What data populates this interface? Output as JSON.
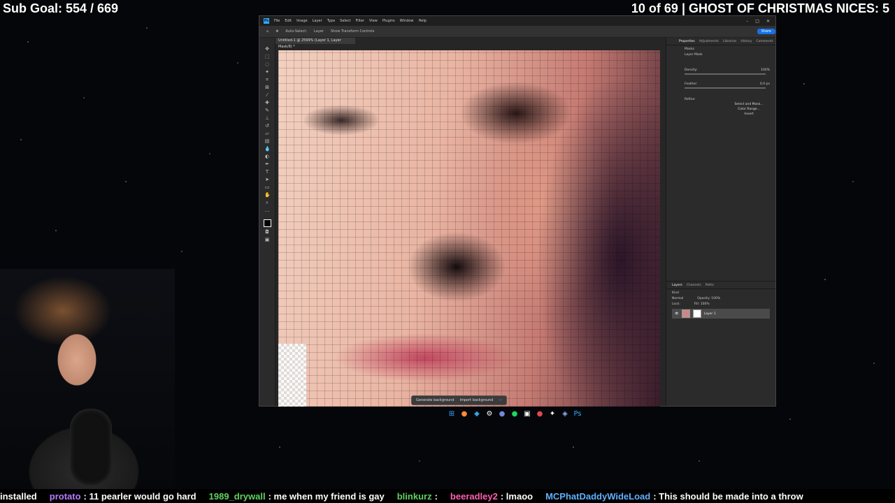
{
  "overlay": {
    "sub_goal": "Sub Goal: 554 / 669",
    "counter": "10 of 69 | GHOST OF CHRISTMAS NICES: 5"
  },
  "photoshop": {
    "menu": [
      "File",
      "Edit",
      "Image",
      "Layer",
      "Type",
      "Select",
      "Filter",
      "View",
      "Plugins",
      "Window",
      "Help"
    ],
    "options": [
      "Auto-Select:",
      "Layer",
      "Show Transform Controls"
    ],
    "share_label": "Share",
    "doc_tab": "Untitled-1 @ 2599% (Layer 1, Layer Mask/8) *",
    "context_bar": [
      "Generate background",
      "Import background"
    ],
    "panel_tabs": [
      "Properties",
      "Adjustments",
      "Libraries",
      "History",
      "Comments"
    ],
    "properties": {
      "section": "Masks",
      "mask_label": "Layer Mask",
      "density_label": "Density:",
      "density_value": "100%",
      "feather_label": "Feather:",
      "feather_value": "0.0 px",
      "refine_label": "Refine:",
      "buttons": [
        "Select and Mask...",
        "Color Range...",
        "Invert"
      ]
    },
    "layers_tabs": [
      "Layers",
      "Channels",
      "Paths"
    ],
    "layers": {
      "kind_label": "Kind",
      "blend_mode": "Normal",
      "opacity": "Opacity: 100%",
      "fill": "Fill: 100%",
      "lock_label": "Lock:",
      "layer_name": "Layer 1"
    }
  },
  "taskbar": [
    "windows-icon",
    "firefox-icon",
    "edge-icon",
    "settings-icon",
    "discord-icon",
    "spotify-icon",
    "app-icon",
    "obs-icon",
    "app2-icon",
    "app3-icon",
    "photoshop-icon"
  ],
  "chat": [
    {
      "user": "",
      "msg": "installed",
      "color": "#ffffff"
    },
    {
      "user": "protato",
      "msg": ": 11 pearler would go hard",
      "color": "#b77cff"
    },
    {
      "user": "1989_drywall",
      "msg": ": me when my friend is gay",
      "color": "#5fd35f"
    },
    {
      "user": "blinkurz",
      "msg": ":",
      "color": "#5fd35f"
    },
    {
      "user": "beeradley2",
      "msg": ": lmaoo",
      "color": "#ff5fb0"
    },
    {
      "user": "MCPhatDaddyWideLoad",
      "msg": ": This should be made into a throw",
      "color": "#5fb0ff"
    }
  ]
}
